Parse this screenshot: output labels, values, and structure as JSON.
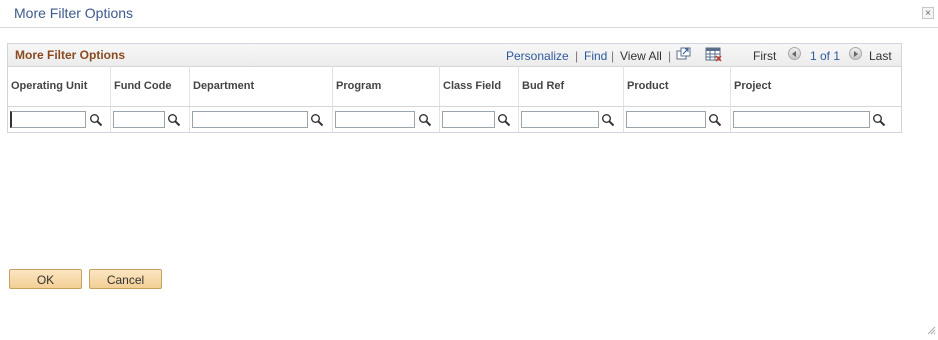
{
  "dialog": {
    "title": "More Filter Options",
    "close_symbol": "×"
  },
  "grid": {
    "title": "More Filter Options",
    "toolbar": {
      "personalize": "Personalize",
      "sep1": "|",
      "find": "Find",
      "sep2": "|",
      "view_all": "View All",
      "sep3": "|",
      "icons": [
        "zoom-grid-icon",
        "download-grid-icon"
      ],
      "first": "First",
      "page_of": "1 of 1",
      "last": "Last"
    },
    "columns": [
      {
        "label": "Operating Unit",
        "value": ""
      },
      {
        "label": "Fund Code",
        "value": ""
      },
      {
        "label": "Department",
        "value": ""
      },
      {
        "label": "Program",
        "value": ""
      },
      {
        "label": "Class Field",
        "value": ""
      },
      {
        "label": "Bud Ref",
        "value": ""
      },
      {
        "label": "Product",
        "value": ""
      },
      {
        "label": "Project",
        "value": ""
      }
    ]
  },
  "buttons": {
    "ok": "OK",
    "cancel": "Cancel"
  },
  "colors": {
    "title_blue": "#3c5a8c",
    "grid_title": "#8a4a1f",
    "link_blue": "#2d5a9c",
    "button_fill": "#f3cf94"
  }
}
